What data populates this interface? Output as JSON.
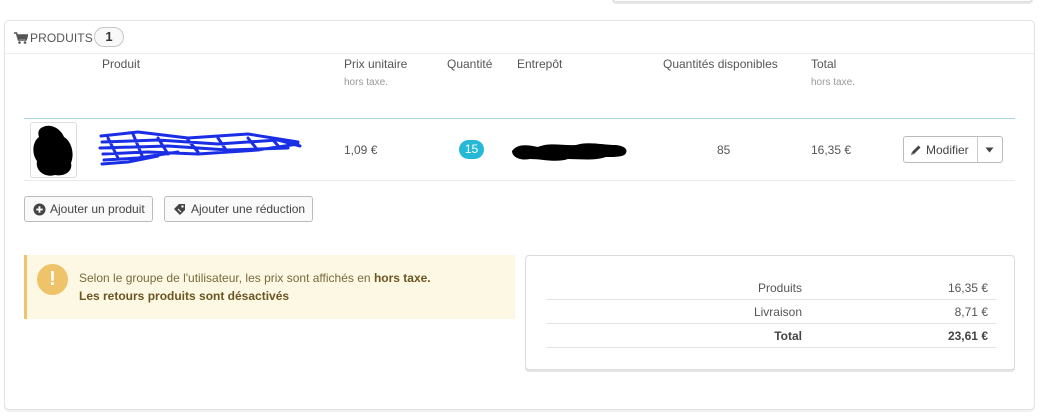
{
  "panel": {
    "title": "PRODUITS",
    "count": "1"
  },
  "table": {
    "headers": {
      "product": "Produit",
      "unit_price": "Prix unitaire",
      "unit_price_sub": "hors taxe.",
      "quantity": "Quantité",
      "warehouse": "Entrepôt",
      "available": "Quantités disponibles",
      "total": "Total",
      "total_sub": "hors taxe."
    },
    "rows": [
      {
        "unit_price": "1,09 €",
        "quantity": "15",
        "available": "85",
        "total": "16,35 €"
      }
    ]
  },
  "buttons": {
    "edit": "Modifier",
    "add_product": "Ajouter un produit",
    "add_discount": "Ajouter une réduction"
  },
  "alert": {
    "text_prefix": "Selon le groupe de l'utilisateur, les prix sont affichés en",
    "text_bold": "hors taxe.",
    "line2": "Les retours produits sont désactivés"
  },
  "totals": [
    {
      "label": "Produits",
      "value": "16,35 €"
    },
    {
      "label": "Livraison",
      "value": "8,71 €"
    },
    {
      "label": "Total",
      "value": "23,61 €"
    }
  ],
  "colors": {
    "accent": "#25b9d7",
    "warning_bg": "#fcf8e3",
    "warning_icon": "#efc36a"
  },
  "icons": [
    "cart-icon",
    "pencil-icon",
    "caret-down-icon",
    "plus-circle-icon",
    "tag-icon",
    "exclamation-icon"
  ]
}
